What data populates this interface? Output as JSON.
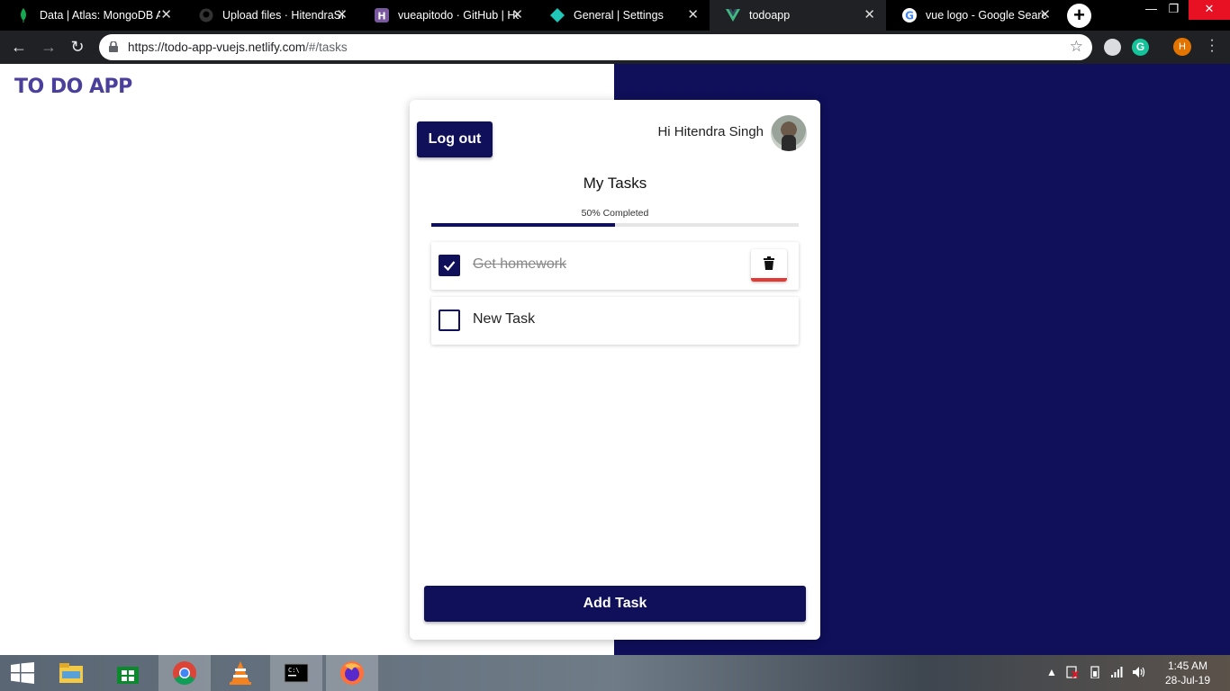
{
  "browser": {
    "tabs": [
      {
        "title": "Data | Atlas: MongoDB Atlas",
        "icon": "mongodb-leaf-icon"
      },
      {
        "title": "Upload files · HitendraSingh",
        "icon": "github-icon"
      },
      {
        "title": "vueapitodo · GitHub | Heroku",
        "icon": "heroku-icon"
      },
      {
        "title": "General | Settings",
        "icon": "netlify-icon"
      },
      {
        "title": "todoapp",
        "icon": "vue-icon"
      },
      {
        "title": "vue logo - Google Search",
        "icon": "google-icon"
      }
    ],
    "url_host": "https://todo-app-vuejs.netlify.com",
    "url_path": "/#/tasks",
    "profile_initial": "H"
  },
  "app": {
    "logo": "TO DO APP",
    "logout_label": "Log out",
    "greeting": "Hi Hitendra Singh",
    "heading": "My Tasks",
    "progress_label": "50% Completed",
    "progress_fraction": 0.5,
    "tasks": [
      {
        "text": "Get homework",
        "done": true
      },
      {
        "text": "New Task",
        "done": false
      }
    ],
    "add_label": "Add Task",
    "colors": {
      "primary": "#0f0f5a",
      "danger": "#e53935",
      "logo": "#4a3f9b"
    }
  },
  "taskbar": {
    "apps": [
      "file-explorer-icon",
      "store-icon",
      "chrome-icon",
      "vlc-icon",
      "cmd-icon",
      "firefox-icon"
    ],
    "time": "1:45 AM",
    "date": "28-Jul-19"
  }
}
